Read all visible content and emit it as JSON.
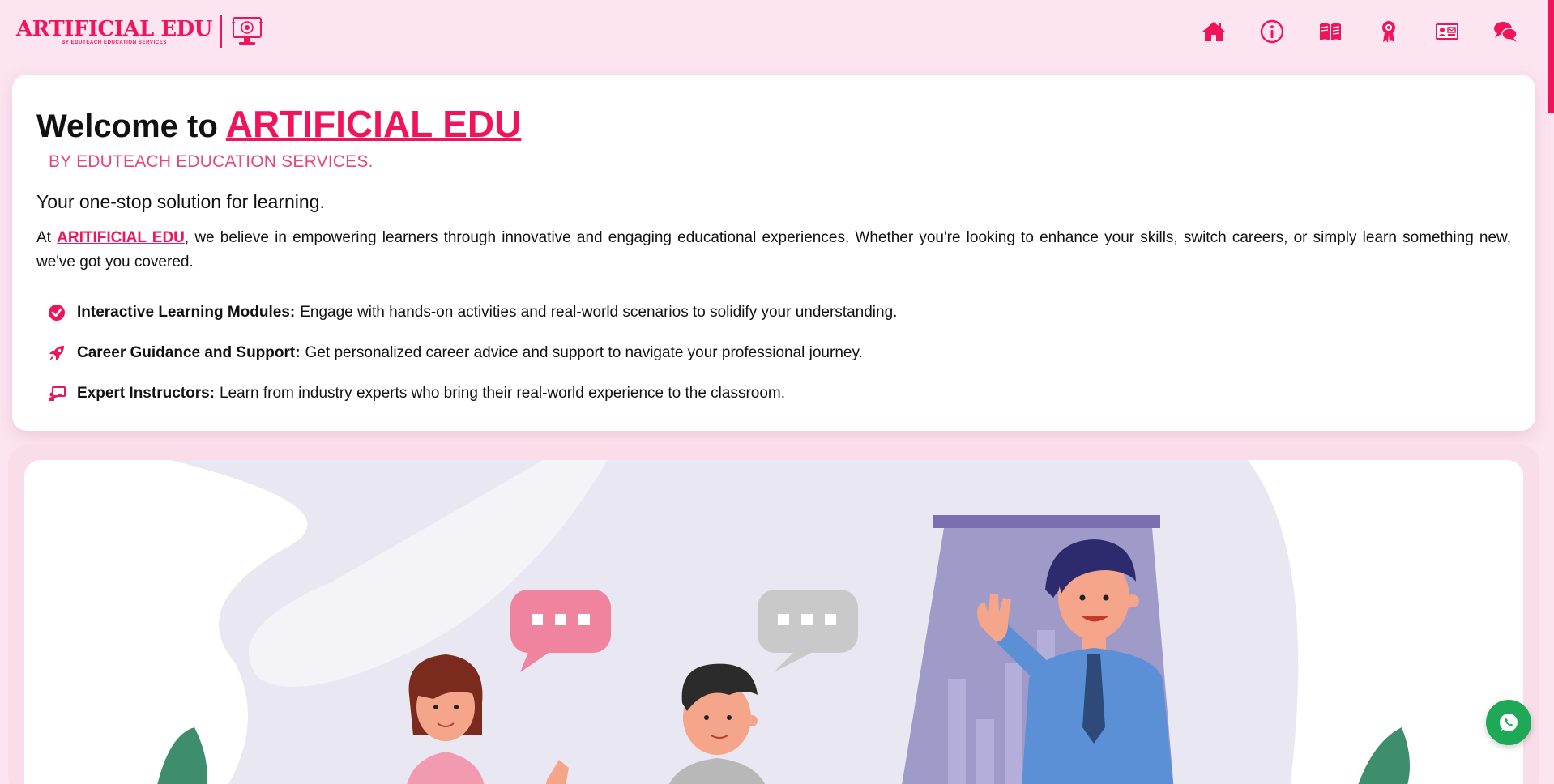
{
  "header": {
    "logo_title": "ARTIFICIAL EDU",
    "logo_subtitle": "BY EDUTEACH EDUCATION SERVICES",
    "nav": [
      {
        "icon": "home-icon",
        "label": "Home"
      },
      {
        "icon": "info-icon",
        "label": "About"
      },
      {
        "icon": "book-icon",
        "label": "Courses"
      },
      {
        "icon": "award-icon",
        "label": "Certificates"
      },
      {
        "icon": "contact-card-icon",
        "label": "Contact"
      },
      {
        "icon": "chat-icon",
        "label": "Chat"
      }
    ]
  },
  "welcome": {
    "prefix": "Welcome to",
    "brand": "ARTIFICIAL EDU",
    "byline": "BY EDUTEACH EDUCATION SERVICES.",
    "tagline": "Your one-stop solution for learning.",
    "intro_before": "At ",
    "intro_link": "ARITIFICIAL EDU",
    "intro_after": ", we believe in empowering learners through innovative and engaging educational experiences. Whether you're looking to enhance your skills, switch careers, or simply learn something new, we've got you covered.",
    "features": [
      {
        "icon": "check-circle-icon",
        "title": "Interactive Learning Modules:",
        "text": "Engage with hands-on activities and real-world scenarios to solidify your understanding."
      },
      {
        "icon": "rocket-icon",
        "title": "Career Guidance and Support:",
        "text": "Get personalized career advice and support to navigate your professional journey."
      },
      {
        "icon": "chalkboard-teacher-icon",
        "title": "Expert Instructors:",
        "text": "Learn from industry experts who bring their real-world experience to the classroom."
      }
    ]
  },
  "illustration": {
    "icon": "classroom-illustration"
  },
  "whatsapp": {
    "icon": "whatsapp-icon"
  },
  "colors": {
    "accent": "#f0145a",
    "background": "#fce4f0",
    "whatsapp": "#1fa855"
  }
}
